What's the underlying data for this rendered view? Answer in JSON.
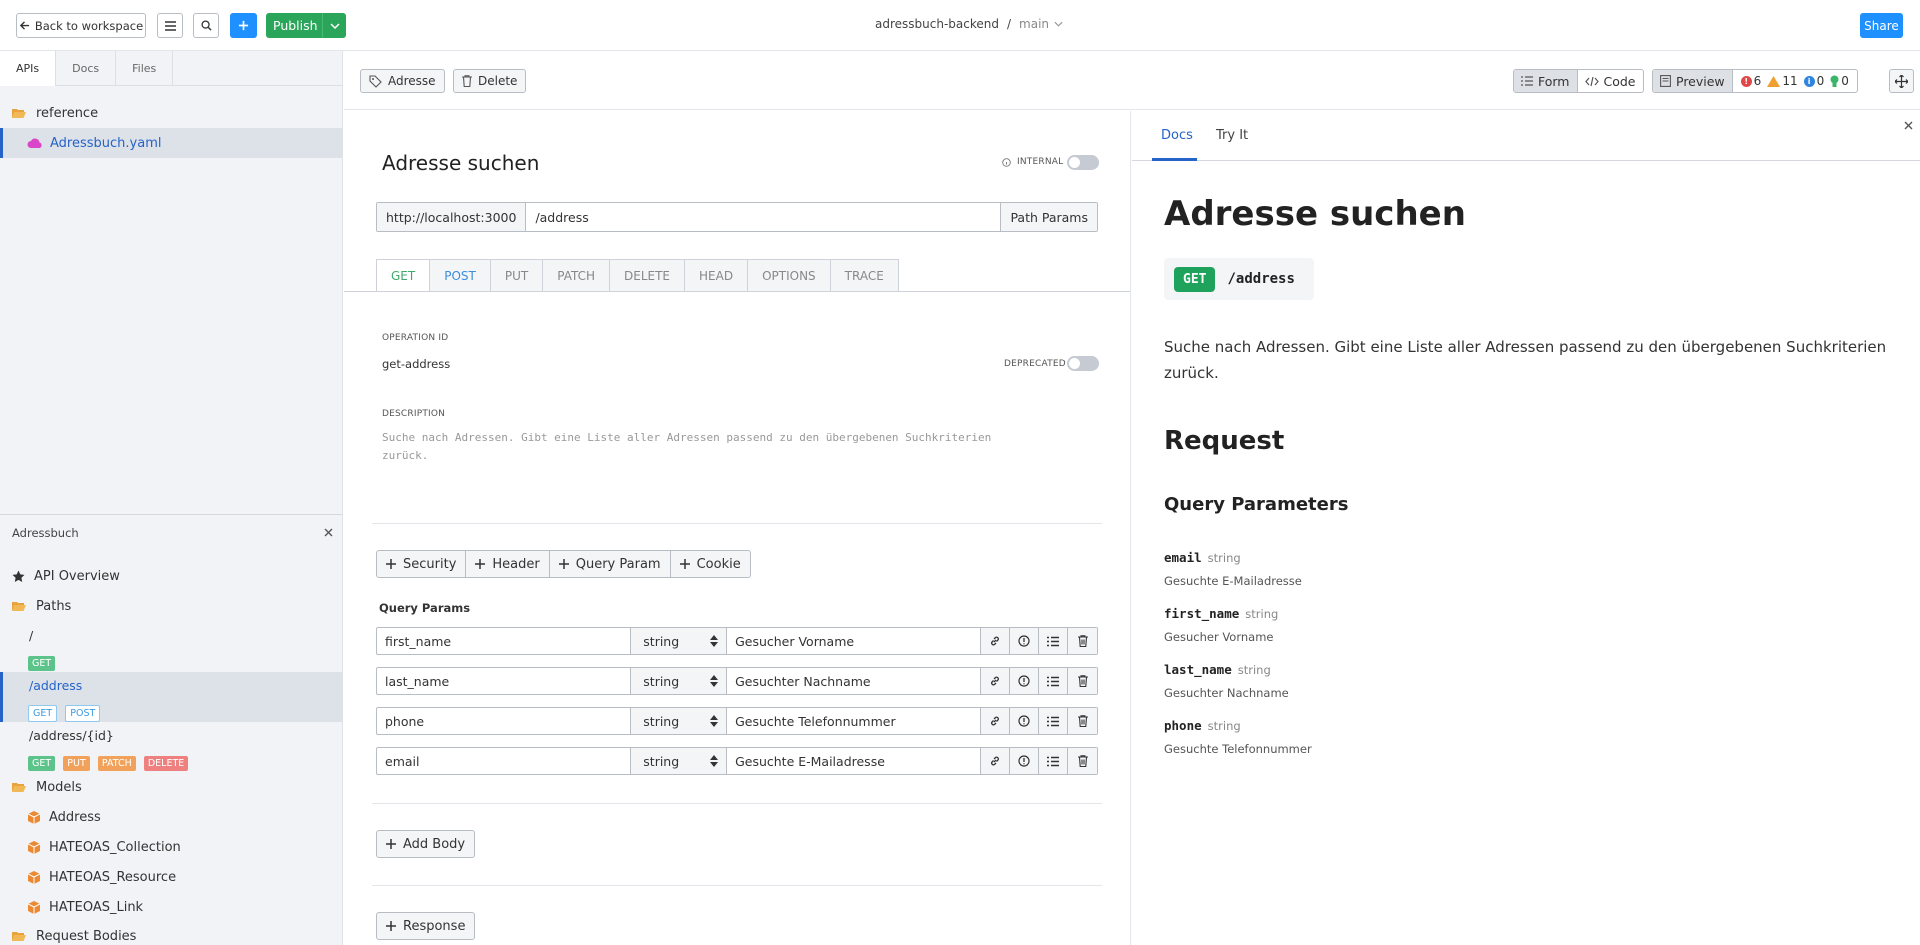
{
  "topbar": {
    "back_label": "Back to workspace",
    "publish_label": "Publish",
    "project": "adressbuch-backend",
    "separator": "/",
    "branch": "main",
    "share_label": "Share"
  },
  "sidebar": {
    "tabs": [
      "APIs",
      "Docs",
      "Files"
    ],
    "tree": {
      "folder": "reference",
      "file": "Adressbuch.yaml"
    },
    "panel": {
      "title": "Adressbuch",
      "api_overview": "API Overview",
      "paths_label": "Paths",
      "paths": [
        {
          "path": "/",
          "methods": [
            "GET"
          ]
        },
        {
          "path": "/address",
          "methods": [
            "GET",
            "POST"
          ]
        },
        {
          "path": "/address/{id}",
          "methods": [
            "GET",
            "PUT",
            "PATCH",
            "DELETE"
          ]
        }
      ],
      "models_label": "Models",
      "models": [
        "Address",
        "HATEOAS_Collection",
        "HATEOAS_Resource",
        "HATEOAS_Link"
      ],
      "request_bodies_label": "Request Bodies"
    }
  },
  "toolbar": {
    "tag_label": "Adresse",
    "delete_label": "Delete",
    "form_label": "Form",
    "code_label": "Code",
    "preview_label": "Preview",
    "errors": "6",
    "warnings": "11",
    "infos": "0",
    "hints": "0"
  },
  "editor": {
    "title": "Adresse suchen",
    "internal_label": "INTERNAL",
    "server": "http://localhost:3000",
    "path": "/address",
    "path_params_label": "Path Params",
    "methods": [
      "GET",
      "POST",
      "PUT",
      "PATCH",
      "DELETE",
      "HEAD",
      "OPTIONS",
      "TRACE"
    ],
    "operation_id_label": "OPERATION ID",
    "operation_id": "get-address",
    "deprecated_label": "DEPRECATED",
    "description_label": "DESCRIPTION",
    "description_line1": "Suche nach Adressen. Gibt eine Liste aller Adressen passend zu den übergebenen Suchkriterien",
    "description_line2": "zurück.",
    "add_buttons": [
      "Security",
      "Header",
      "Query Param",
      "Cookie"
    ],
    "query_params_label": "Query Params",
    "query_params": [
      {
        "name": "first_name",
        "type": "string",
        "description": "Gesucher Vorname"
      },
      {
        "name": "last_name",
        "type": "string",
        "description": "Gesuchter Nachname"
      },
      {
        "name": "phone",
        "type": "string",
        "description": "Gesuchte Telefonnummer"
      },
      {
        "name": "email",
        "type": "string",
        "description": "Gesuchte E-Mailadresse"
      }
    ],
    "add_body_label": "Add Body",
    "response_label": "Response"
  },
  "preview": {
    "tabs": [
      "Docs",
      "Try It"
    ],
    "title": "Adresse suchen",
    "method": "GET",
    "path": "/address",
    "description_line1": "Suche nach Adressen. Gibt eine Liste aller Adressen passend zu den übergebenen Suchkriterien",
    "description_line2": "zurück.",
    "request_heading": "Request",
    "query_heading": "Query Parameters",
    "params": [
      {
        "name": "email",
        "type": "string",
        "description": "Gesuchte E-Mailadresse"
      },
      {
        "name": "first_name",
        "type": "string",
        "description": "Gesucher Vorname"
      },
      {
        "name": "last_name",
        "type": "string",
        "description": "Gesuchter Nachname"
      },
      {
        "name": "phone",
        "type": "string",
        "description": "Gesuchte Telefonnummer"
      }
    ]
  },
  "colors": {
    "accent": "#2563c9",
    "publish": "#2aa55a",
    "blue_button": "#1e90ff",
    "get_badge": "#1fa35c"
  }
}
